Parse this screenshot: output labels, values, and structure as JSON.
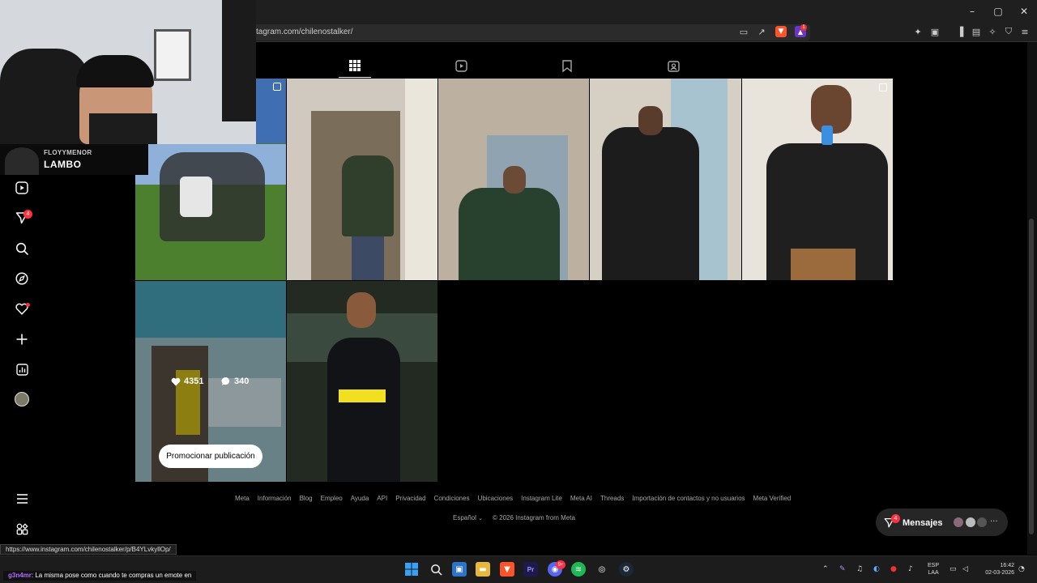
{
  "browser": {
    "url_visible": "tagram.com/chilenostalker/",
    "window_controls": [
      "minimize-icon",
      "maximize-icon",
      "close-icon"
    ],
    "window_glyphs": [
      "–",
      "▢",
      "✕"
    ],
    "rewards_count": "1",
    "status_url": "https://www.instagram.com/chilenostalker/p/B4YLvkyllOp/"
  },
  "profile_tabs": [
    {
      "name": "posts",
      "icon": "grid-icon",
      "active": true
    },
    {
      "name": "reels",
      "icon": "reels-icon",
      "active": false
    },
    {
      "name": "saved",
      "icon": "bookmark-icon",
      "active": false
    },
    {
      "name": "tagged",
      "icon": "tagged-user-icon",
      "active": false
    }
  ],
  "hovered_post": {
    "likes": "4351",
    "comments": "340",
    "promote_label": "Promocionar publicación"
  },
  "sidebar": {
    "items": [
      {
        "icon": "reels-icon"
      },
      {
        "icon": "messenger-icon",
        "badge": "4"
      },
      {
        "icon": "search-icon"
      },
      {
        "icon": "explore-compass-icon"
      },
      {
        "icon": "heart-notifications-icon",
        "dot": true
      },
      {
        "icon": "create-plus-icon"
      },
      {
        "icon": "dashboard-chart-icon"
      },
      {
        "icon": "profile-avatar"
      }
    ],
    "more_icon": "hamburger-menu-icon",
    "meta_icon": "also-from-meta-icon"
  },
  "webcam": {
    "subtitle": "FLOYYMENOR",
    "title": "LAMBO"
  },
  "footer": {
    "links": [
      "Meta",
      "Información",
      "Blog",
      "Empleo",
      "Ayuda",
      "API",
      "Privacidad",
      "Condiciones",
      "Ubicaciones",
      "Instagram Lite",
      "Meta AI",
      "Threads",
      "Importación de contactos y no usuarios",
      "Meta Verified"
    ],
    "language": "Español",
    "copyright": "© 2026 Instagram from Meta"
  },
  "messages": {
    "label": "Mensajes",
    "badge": "4"
  },
  "chat": {
    "user": "g3n4mr",
    "message": ": La misma pose como cuando te compras un emote en"
  },
  "taskbar": {
    "language": "ESP",
    "layout": "LAA",
    "time": "16:42",
    "date": "02-03-2026",
    "discord_badge": "9+"
  },
  "colors": {
    "background": "#000000",
    "badge": "#ff3040",
    "brave": "#fb542b"
  }
}
